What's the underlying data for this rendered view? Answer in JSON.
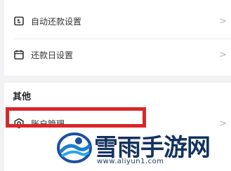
{
  "settings": {
    "items": [
      {
        "label": "自动还款设置",
        "icon": "card-icon"
      },
      {
        "label": "还款日设置",
        "icon": "calendar-icon"
      }
    ],
    "other": {
      "title": "其他",
      "items": [
        {
          "label": "账户管理",
          "icon": "gear-hexagon-icon"
        }
      ]
    },
    "chevron": ">"
  },
  "highlight": {
    "color": "#d9262a"
  },
  "watermark": {
    "title": "雪雨手游网",
    "url": "www.aliyun1.com"
  }
}
